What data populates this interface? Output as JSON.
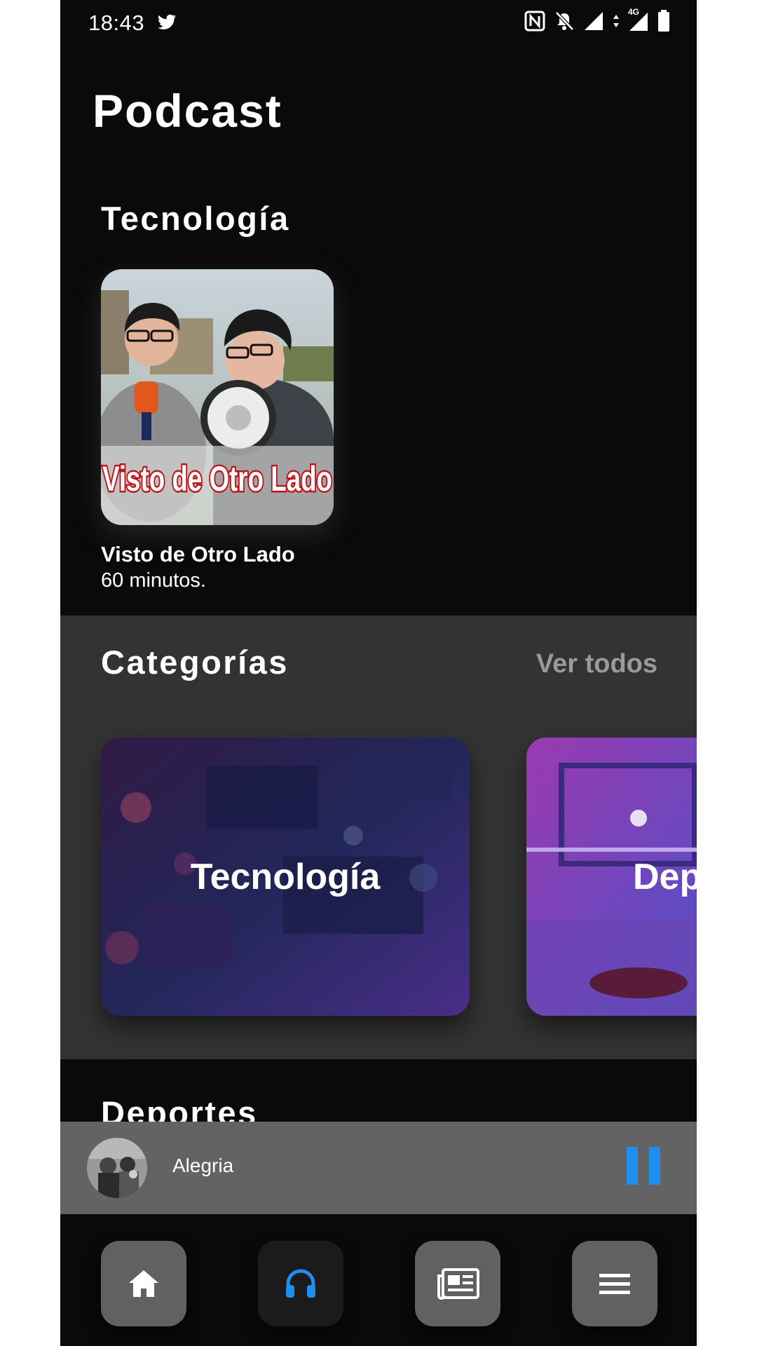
{
  "status_bar": {
    "time": "18:43",
    "network": "4G"
  },
  "header": {
    "title": "Podcast"
  },
  "featured": {
    "section_title": "Tecnología",
    "podcast": {
      "name": "Visto de Otro Lado",
      "duration": "60 minutos.",
      "cover_text": "Visto de Otro Lado"
    }
  },
  "categories": {
    "title": "Categorías",
    "see_all_label": "Ver todos",
    "items": [
      {
        "label": "Tecnología"
      },
      {
        "label": "Dep"
      }
    ]
  },
  "next_section": {
    "title": "Deportes"
  },
  "player": {
    "track_title": "Alegria",
    "accent_color": "#1f8ef1",
    "state": "playing"
  },
  "bottom_nav": {
    "items": [
      {
        "icon": "home-icon",
        "active": false
      },
      {
        "icon": "headphones-icon",
        "active": true
      },
      {
        "icon": "newspaper-icon",
        "active": false
      },
      {
        "icon": "menu-icon",
        "active": false
      }
    ]
  },
  "colors": {
    "background": "#0a0a0a",
    "categories_band": "#333333",
    "player_bar": "#636363",
    "accent": "#1f8ef1"
  }
}
